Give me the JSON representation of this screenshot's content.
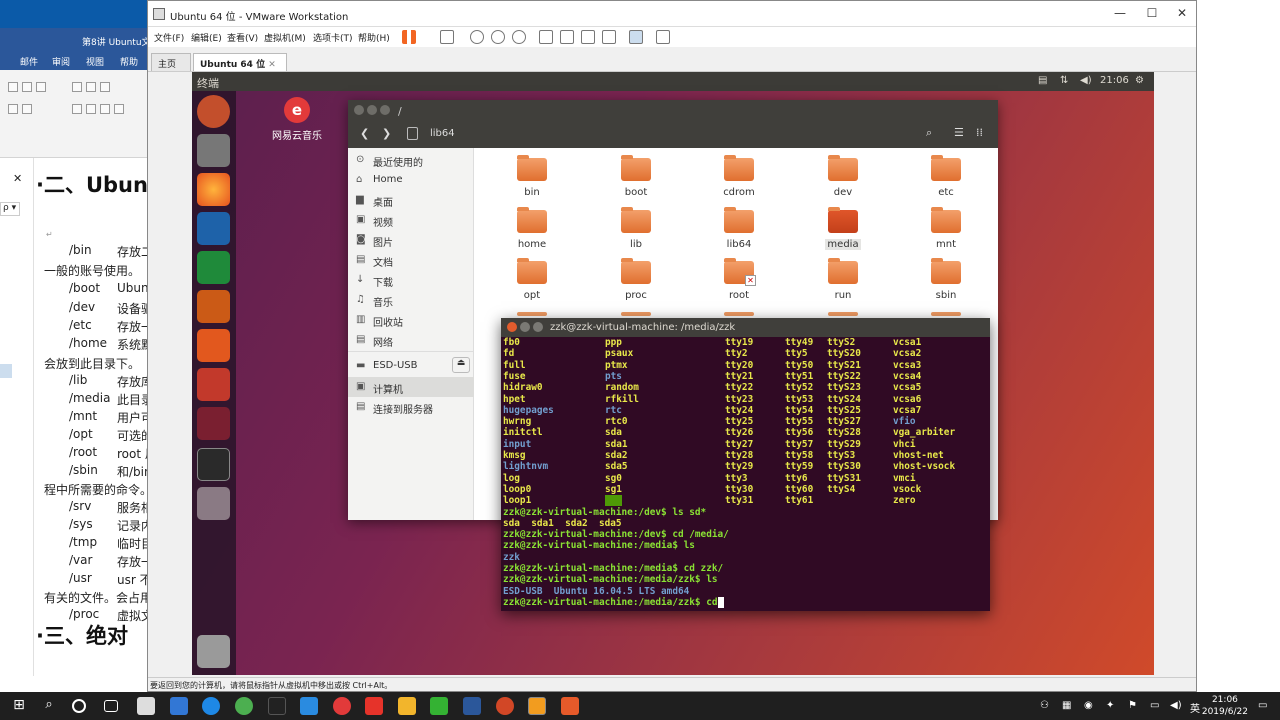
{
  "word": {
    "title_frag": "第8讲 Ubuntu文件",
    "tabs": [
      "邮件",
      "审阅",
      "视图",
      "帮助"
    ],
    "heading1": "·二、Ubun",
    "heading2": "·三、绝对",
    "nav_close": "✕",
    "nav_search": "ρ ▾",
    "lines": [
      {
        "c1": "/bin",
        "c2": "存放二"
      },
      {
        "text": "一般的账号使用。"
      },
      {
        "c1": "/boot",
        "c2": "Ubun"
      },
      {
        "c1": "/dev",
        "c2": "设备驱"
      },
      {
        "c1": "/etc",
        "c2": "存放一"
      },
      {
        "c1": "/home",
        "c2": "系统默"
      },
      {
        "text": "会放到此目录下。"
      },
      {
        "c1": "/lib",
        "c2": "存放库"
      },
      {
        "c1": "/media",
        "c2": "此目录"
      },
      {
        "c1": "/mnt",
        "c2": "用户可"
      },
      {
        "c1": "/opt",
        "c2": "可选的"
      },
      {
        "c1": "/root",
        "c2": "root 用"
      },
      {
        "c1": "/sbin",
        "c2": "和/bin"
      },
      {
        "text": "程中所需要的命令。"
      },
      {
        "c1": "/srv",
        "c2": "服务相"
      },
      {
        "c1": "/sys",
        "c2": "记录内"
      },
      {
        "c1": "/tmp",
        "c2": "临时目"
      },
      {
        "c1": "/var",
        "c2": "存放一"
      },
      {
        "c1": "/usr",
        "c2": "usr 不"
      },
      {
        "text": "有关的文件。会占用"
      },
      {
        "c1": "/proc",
        "c2": "虚拟文"
      }
    ]
  },
  "vmware": {
    "title": "Ubuntu 64 位 - VMware Workstation",
    "menu": [
      "文件(F)",
      "编辑(E)",
      "查看(V)",
      "虚拟机(M)",
      "选项卡(T)",
      "帮助(H)"
    ],
    "tabs": [
      "主页",
      "Ubuntu 64 位"
    ],
    "status": "要返回到您的计算机，请将鼠标指针从虚拟机中移出或按 Ctrl+Alt。",
    "win_controls": [
      "—",
      "☐",
      "✕"
    ]
  },
  "ubuntu": {
    "topbar_title": "终端",
    "time": "21:06",
    "desktop_icon_label": "网易云音乐",
    "files": {
      "path_title": "/",
      "location": "lib64",
      "sidebar": [
        {
          "icon": "recent-icon",
          "glyph": "⊙",
          "label": "最近使用的"
        },
        {
          "icon": "home-icon",
          "glyph": "⌂",
          "label": "Home"
        },
        {
          "icon": "desktop-icon",
          "glyph": "▆",
          "label": "桌面"
        },
        {
          "icon": "video-icon",
          "glyph": "▣",
          "label": "视频"
        },
        {
          "icon": "pictures-icon",
          "glyph": "◙",
          "label": "图片"
        },
        {
          "icon": "documents-icon",
          "glyph": "▤",
          "label": "文档"
        },
        {
          "icon": "downloads-icon",
          "glyph": "↓",
          "label": "下载"
        },
        {
          "icon": "music-icon",
          "glyph": "♫",
          "label": "音乐"
        },
        {
          "icon": "trash-icon",
          "glyph": "▥",
          "label": "回收站"
        },
        {
          "icon": "network-icon",
          "glyph": "▤",
          "label": "网络"
        },
        {
          "icon": "usb-icon",
          "glyph": "▬",
          "label": "ESD-USB"
        },
        {
          "icon": "computer-icon",
          "glyph": "▣",
          "label": "计算机"
        },
        {
          "icon": "connect-server-icon",
          "glyph": "▤",
          "label": "连接到服务器"
        }
      ],
      "folders": [
        "bin",
        "boot",
        "cdrom",
        "dev",
        "etc",
        "home",
        "lib",
        "lib64",
        "media",
        "mnt",
        "opt",
        "proc",
        "root",
        "run",
        "sbin"
      ]
    },
    "terminal": {
      "title": "zzk@zzk-virtual-machine: /media/zzk",
      "dev_cols": [
        [
          "fb0",
          "fd",
          "full",
          "fuse",
          "hidraw0",
          "hpet",
          "hugepages",
          "hwrng",
          "initctl",
          "input",
          "kmsg",
          "lightnvm",
          "log",
          "loop0",
          "loop1"
        ],
        [
          "ppp",
          "psaux",
          "ptmx",
          "pts",
          "random",
          "rfkill",
          "rtc",
          "rtc0",
          "sda",
          "sda1",
          "sda2",
          "sda5",
          "sg0",
          "sg1",
          "shm"
        ],
        [
          "tty19",
          "tty2",
          "tty20",
          "tty21",
          "tty22",
          "tty23",
          "tty24",
          "tty25",
          "tty26",
          "tty27",
          "tty28",
          "tty29",
          "tty3",
          "tty30",
          "tty31"
        ],
        [
          "tty49",
          "tty5",
          "tty50",
          "tty51",
          "tty52",
          "tty53",
          "tty54",
          "tty55",
          "tty56",
          "tty57",
          "tty58",
          "tty59",
          "tty6",
          "tty60",
          "tty61"
        ],
        [
          "ttyS2",
          "ttyS20",
          "ttyS21",
          "ttyS22",
          "ttyS23",
          "ttyS24",
          "ttyS25",
          "ttyS27",
          "ttyS28",
          "ttyS29",
          "ttyS3",
          "ttyS30",
          "ttyS31",
          "ttyS4",
          ""
        ],
        [
          "vcsa1",
          "vcsa2",
          "vcsa3",
          "vcsa4",
          "vcsa5",
          "vcsa6",
          "vcsa7",
          "vfio",
          "vga_arbiter",
          "vhci",
          "vhost-net",
          "vhost-vsock",
          "vmci",
          "vsock",
          "zero"
        ]
      ],
      "p1": "zzk@zzk-virtual-machine:/dev$ ls sd*",
      "o1": "sda  sda1  sda2  sda5",
      "p2": "zzk@zzk-virtual-machine:/dev$ cd /media/",
      "p3": "zzk@zzk-virtual-machine:/media$ ls",
      "o3": "zzk",
      "p4": "zzk@zzk-virtual-machine:/media$ cd zzk/",
      "p5": "zzk@zzk-virtual-machine:/media/zzk$ ls",
      "o5": "ESD-USB  Ubuntu 16.04.5 LTS amd64",
      "p6": "zzk@zzk-virtual-machine:/media/zzk$ cd"
    }
  },
  "taskbar": {
    "time": "21:06",
    "date": "2019/6/22"
  }
}
